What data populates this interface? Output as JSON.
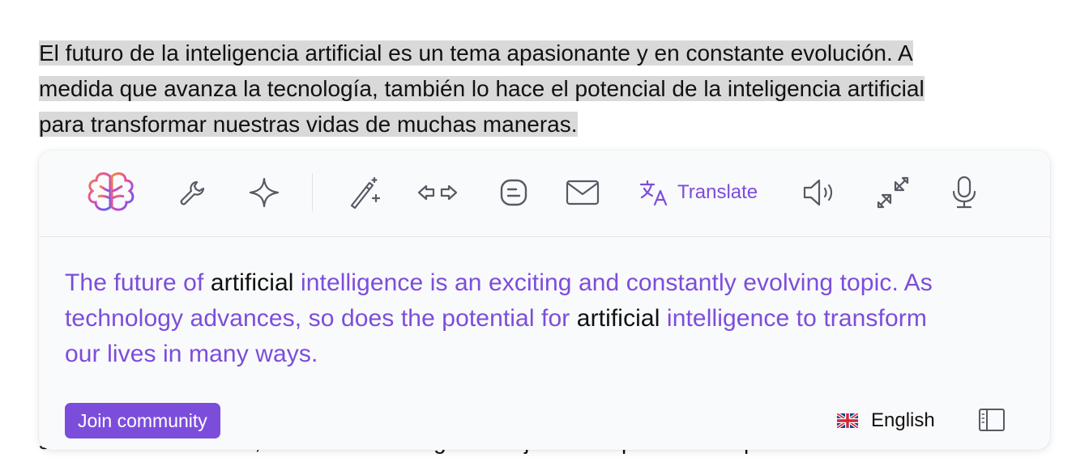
{
  "source": {
    "line1": "El futuro de la inteligencia artificial es un tema apasionante y en constante evolución. A",
    "line2": "medida que avanza la tecnología, también lo hace el potencial de la inteligencia artificial",
    "line3": "para transformar nuestras vidas de muchas maneras."
  },
  "behind_text": "sobre diversos temas, como las estrategias de fijación de precios o la predicción del",
  "toolbar": {
    "icons": [
      "brain-logo-icon",
      "wrench-icon",
      "sparkle-icon",
      "magic-wand-icon",
      "arrows-left-right-icon",
      "chat-bubble-icon",
      "mail-icon",
      "translate-icon",
      "speaker-icon",
      "collapse-arrows-icon",
      "microphone-icon"
    ],
    "translate_label": "Translate"
  },
  "translation": {
    "segments": [
      {
        "text": "The future of ",
        "style": "accent"
      },
      {
        "text": "artificial",
        "style": "plain"
      },
      {
        "text": " intelligence is an exciting and constantly evolving topic. As technology advances, so does the potential for ",
        "style": "accent"
      },
      {
        "text": "artificial",
        "style": "plain"
      },
      {
        "text": " intelligence to transform our lives in many ways.",
        "style": "accent"
      }
    ]
  },
  "footer": {
    "join_label": "Join community",
    "language": "English",
    "language_flag": "uk-flag-icon"
  },
  "colors": {
    "accent": "#7c4ddb",
    "highlight": "#d9d9d9",
    "text": "#111111",
    "icon": "#555a64"
  }
}
